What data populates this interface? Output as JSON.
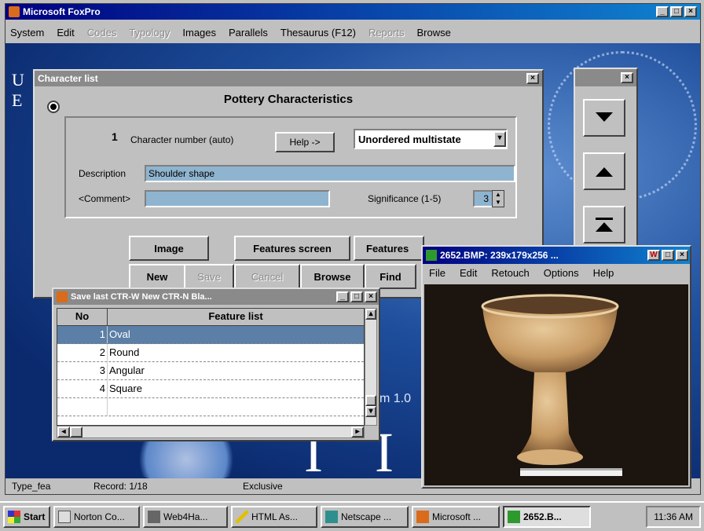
{
  "app": {
    "title": "Microsoft FoxPro",
    "menu": [
      {
        "label": "System",
        "disabled": false
      },
      {
        "label": "Edit",
        "disabled": false
      },
      {
        "label": "Codes",
        "disabled": true
      },
      {
        "label": "Typology",
        "disabled": true
      },
      {
        "label": "Images",
        "disabled": false
      },
      {
        "label": "Parallels",
        "disabled": false
      },
      {
        "label": "Thesaurus (F12)",
        "disabled": false
      },
      {
        "label": "Reports",
        "disabled": true
      },
      {
        "label": "Browse",
        "disabled": false
      }
    ],
    "status": {
      "table": "Type_fea",
      "record": "Record: 1/18",
      "mode": "Exclusive"
    }
  },
  "background": {
    "left_letters": "U\nE",
    "version_fragment": "m 1.0",
    "big_letters": "I I P"
  },
  "char_list": {
    "title": "Character list",
    "heading": "Pottery Characteristics",
    "char_number": "1",
    "char_number_label": "Character number (auto)",
    "help_label": "Help ->",
    "type_value": "Unordered multistate",
    "description_label": "Description",
    "description_value": "Shoulder shape",
    "comment_label": "<Comment>",
    "comment_value": "",
    "significance_label": "Significance (1-5)",
    "significance_value": "3",
    "buttons": {
      "image": "Image",
      "features_screen": "Features screen",
      "features_other": "Features",
      "new": "New",
      "save": "Save",
      "cancel": "Cancel",
      "browse": "Browse",
      "find": "Find"
    }
  },
  "nav_panel": {
    "down_icon": "triangle-down",
    "up_icon": "triangle-up",
    "top_icon": "triangle-top"
  },
  "feature_window": {
    "title": "Save last CTR-W  New CTR-N  Bla...",
    "col_no": "No",
    "col_feature": "Feature list",
    "rows": [
      {
        "no": "1",
        "feature": "Oval"
      },
      {
        "no": "2",
        "feature": "Round"
      },
      {
        "no": "3",
        "feature": "Angular"
      },
      {
        "no": "4",
        "feature": "Square"
      }
    ]
  },
  "image_viewer": {
    "title": "2652.BMP: 239x179x256 ...",
    "menu": [
      "File",
      "Edit",
      "Retouch",
      "Options",
      "Help"
    ]
  },
  "taskbar": {
    "start": "Start",
    "tasks": [
      "Norton Co...",
      "Web4Ha...",
      "HTML As...",
      "Netscape ...",
      "Microsoft ...",
      "2652.B..."
    ],
    "active_index": 5,
    "clock": "11:36 AM"
  },
  "colors": {
    "title_active": "#000080",
    "field": "#8fb4cf",
    "desktop": "#1e4e9c"
  }
}
